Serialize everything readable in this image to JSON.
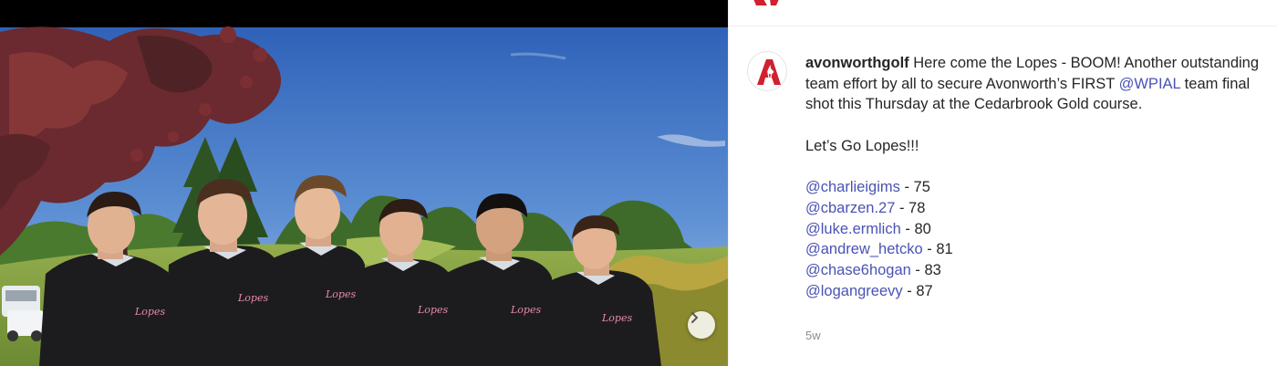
{
  "post": {
    "username": "avonworthgolf",
    "caption_line1": " Here come the Lopes - BOOM! Another outstanding team effort by all to secure Avonworth’s FIRST ",
    "wpial_mention": "@WPIAL",
    "caption_line2": " team final shot this Thursday at the Cedarbrook Gold course.",
    "cheer": "Let’s Go Lopes!!!",
    "scores": [
      {
        "handle": "@charlieigims",
        "score": " - 75"
      },
      {
        "handle": "@cbarzen.27",
        "score": " - 78"
      },
      {
        "handle": "@luke.ermlich",
        "score": " - 80"
      },
      {
        "handle": "@andrew_hetcko",
        "score": " - 81"
      },
      {
        "handle": "@chase6hogan",
        "score": " - 83"
      },
      {
        "handle": "@logangreevy",
        "score": " - 87"
      }
    ],
    "timestamp": "5w"
  },
  "media": {
    "hoodie_text": "Lopes",
    "carousel_next_icon": "chevron-right-icon"
  },
  "colors": {
    "brand_red": "#d1202f",
    "mention_blue": "#4a53b4",
    "sky": "#3f74c4",
    "grass": "#7f9c3d",
    "hoodie": "#1c1c1e"
  }
}
